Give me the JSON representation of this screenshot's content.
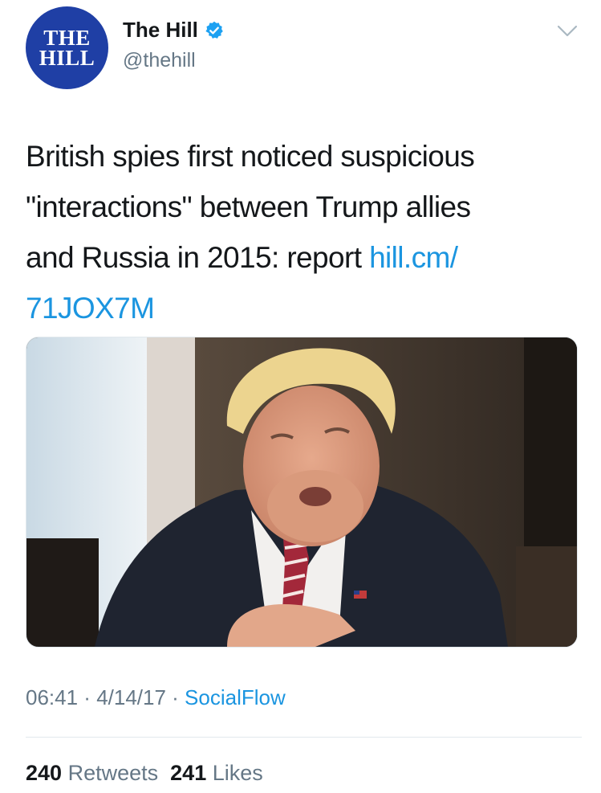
{
  "account": {
    "avatar_line1": "THE",
    "avatar_line2": "HILL",
    "name": "The Hill",
    "handle": "@thehill",
    "avatar_color": "#1f3fa5",
    "verified_icon": "verified-badge-icon",
    "menu_icon": "chevron-down-icon"
  },
  "tweet": {
    "text_line1": "British spies first noticed suspicious",
    "text_line2": "\"interactions\" between Trump allies",
    "text_line3": "and Russia in 2015: report ",
    "link_part1": "hill.cm/",
    "link_part2": "71JOX7M",
    "link_color": "#1b95e0"
  },
  "meta": {
    "time": "06:41",
    "separator": " · ",
    "date": "4/14/17",
    "source": "SocialFlow"
  },
  "stats": {
    "retweets_count": "240",
    "retweets_label": "Retweets",
    "likes_count": "241",
    "likes_label": "Likes"
  }
}
